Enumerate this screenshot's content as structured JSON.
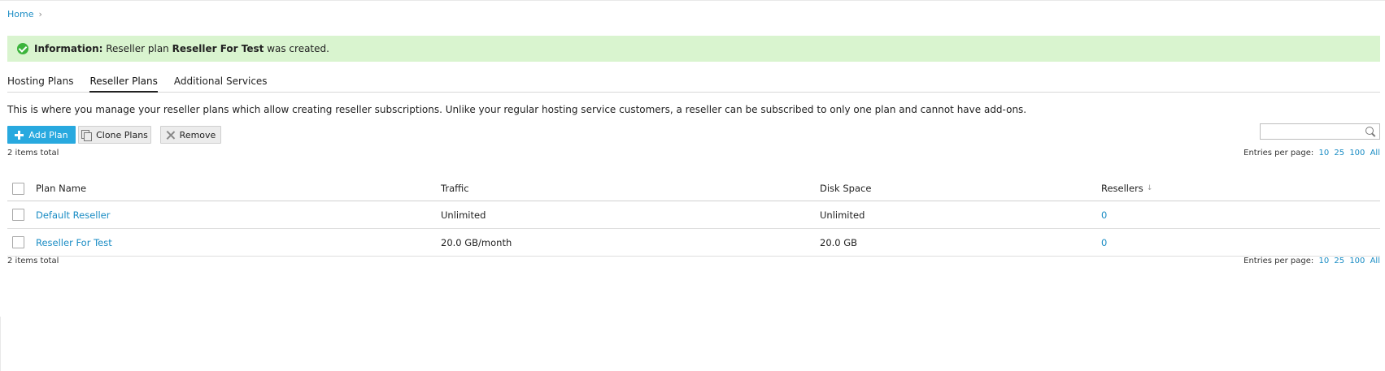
{
  "breadcrumb": {
    "home": "Home",
    "separator": "›"
  },
  "info": {
    "label": "Information:",
    "text_before": " Reseller plan ",
    "plan_name": "Reseller For Test",
    "text_after": " was created."
  },
  "tabs": [
    {
      "label": "Hosting Plans",
      "active": false
    },
    {
      "label": "Reseller Plans",
      "active": true
    },
    {
      "label": "Additional Services",
      "active": false
    }
  ],
  "description": "This is where you manage your reseller plans which allow creating reseller subscriptions. Unlike your regular hosting service customers, a reseller can be subscribed to only one plan and cannot have add-ons.",
  "toolbar": {
    "add_label": "Add Plan",
    "clone_label": "Clone Plans",
    "remove_label": "Remove",
    "search_placeholder": ""
  },
  "totals": "2 items total",
  "entries": {
    "label": "Entries per page:",
    "options": [
      "10",
      "25",
      "100",
      "All"
    ]
  },
  "table": {
    "columns": {
      "name": "Plan Name",
      "traffic": "Traffic",
      "disk": "Disk Space",
      "resellers": "Resellers",
      "sort_indicator": "↓"
    },
    "rows": [
      {
        "name": "Default Reseller",
        "traffic": "Unlimited",
        "disk": "Unlimited",
        "resellers": "0"
      },
      {
        "name": "Reseller For Test",
        "traffic": "20.0 GB/month",
        "disk": "20.0 GB",
        "resellers": "0"
      }
    ]
  },
  "colors": {
    "link": "#1a8cc4",
    "primary_button": "#28a9df",
    "info_background": "#d9f4cf",
    "success_icon": "#3cb43c"
  }
}
